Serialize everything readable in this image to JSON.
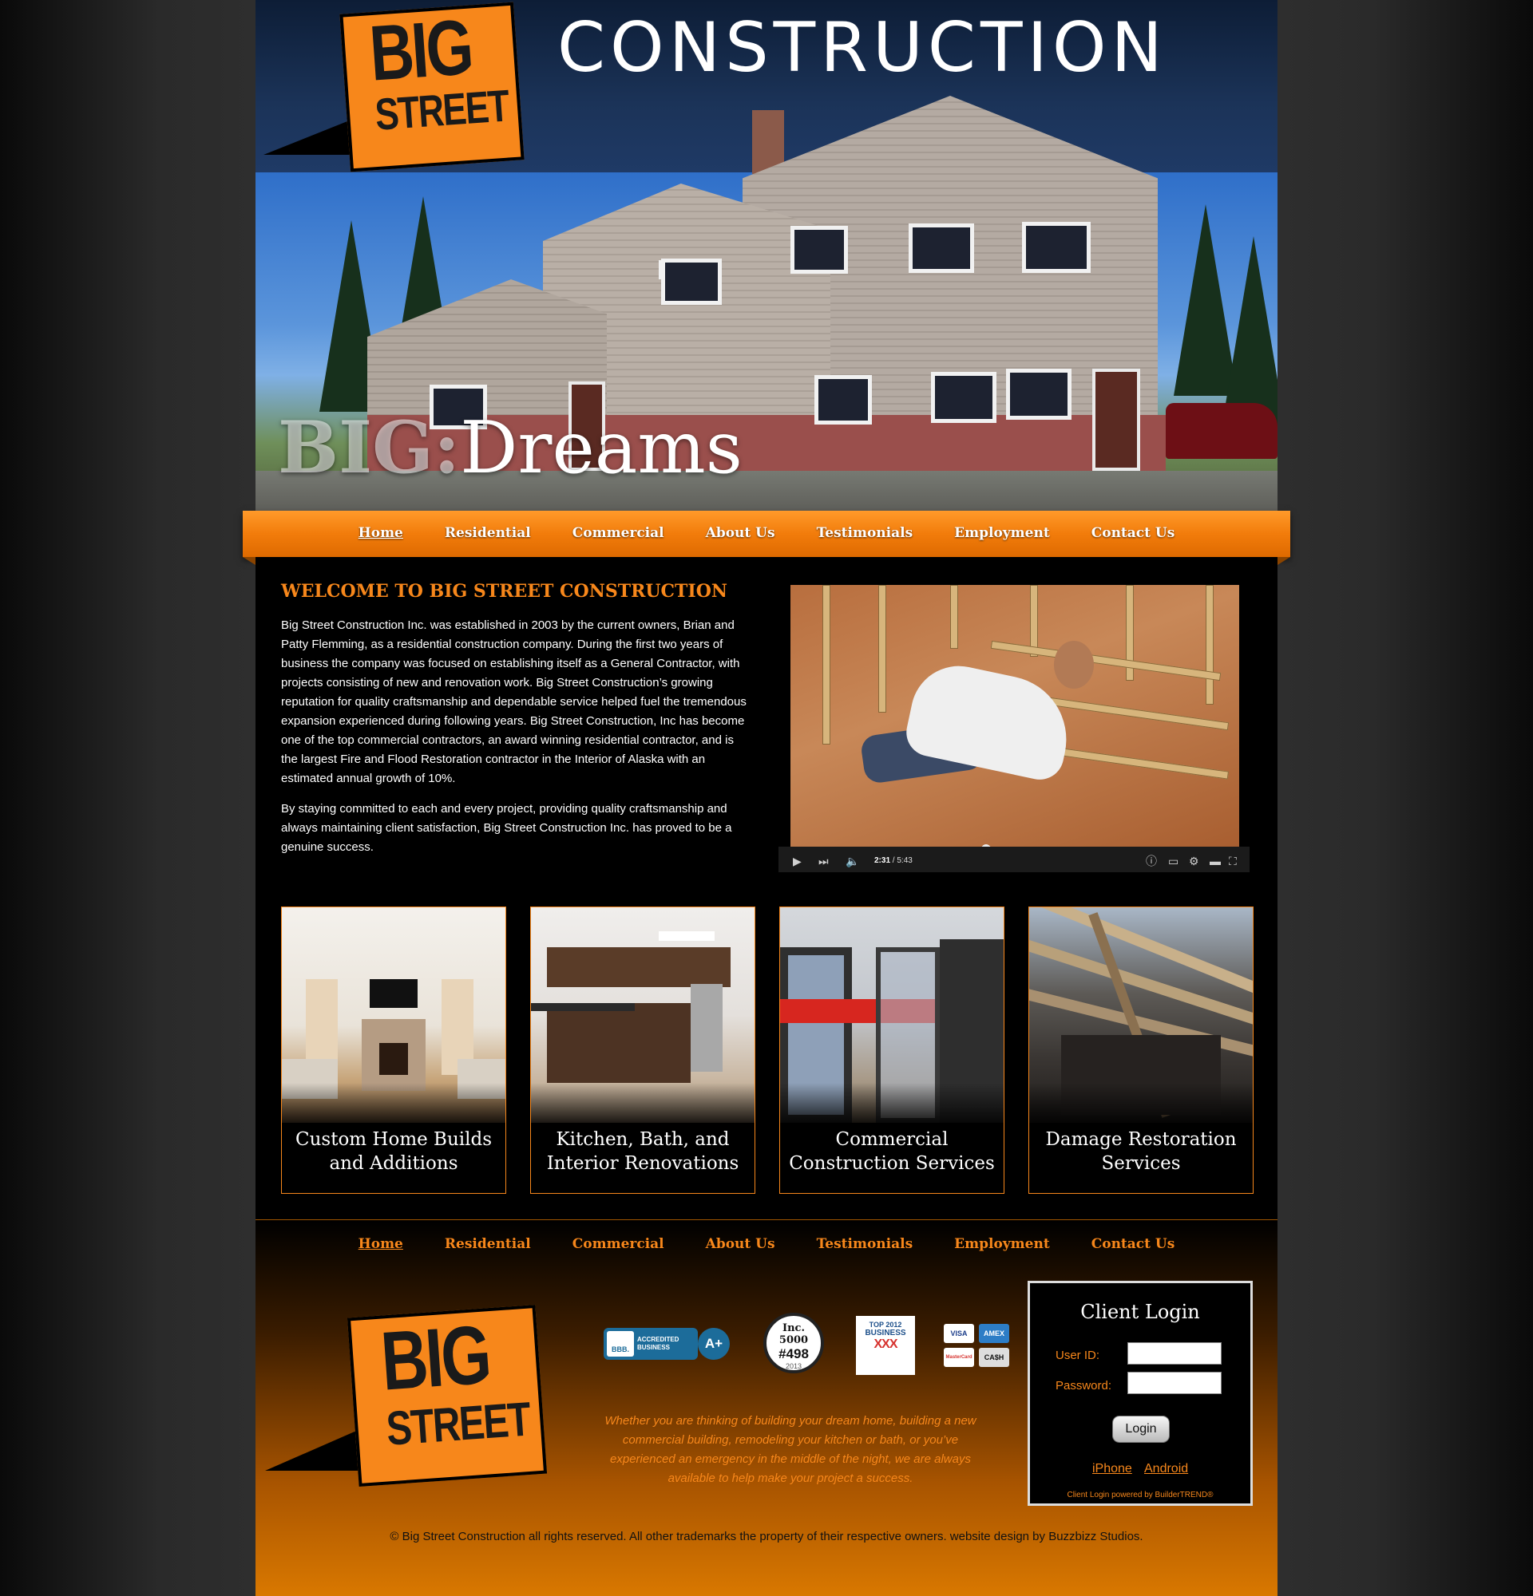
{
  "header": {
    "logo_line1": "BIG",
    "logo_line2": "STREET",
    "title": "CONSTRUCTION",
    "hero_text_bold": "BIG:",
    "hero_text": "Dreams"
  },
  "nav": {
    "items": [
      {
        "label": "Home",
        "active": true
      },
      {
        "label": "Residential"
      },
      {
        "label": "Commercial"
      },
      {
        "label": "About Us"
      },
      {
        "label": "Testimonials"
      },
      {
        "label": "Employment"
      },
      {
        "label": "Contact Us"
      }
    ]
  },
  "welcome": {
    "title": "WELCOME TO BIG STREET CONSTRUCTION",
    "paragraph1": "Big Street Construction Inc. was established in 2003 by the current owners, Brian and Patty Flemming, as a residential construction company. During the first two years of business the company was focused on establishing itself as a General Contractor, with projects consisting of new and renovation work. Big Street Construction’s growing reputation for quality craftsmanship and dependable service helped fuel the tremendous expansion experienced during following years. Big Street Construction, Inc has become one of the top commercial contractors, an award winning residential contractor, and is the largest Fire and Flood Restoration contractor in the Interior of Alaska with an estimated annual growth of 10%.",
    "paragraph2": "By staying committed to each and every project, providing quality craftsmanship and always maintaining client satisfaction, Big Street Construction Inc. has proved to be a genuine success."
  },
  "video": {
    "time_current": "2:31",
    "time_total": "/ 5:43",
    "progress": 0.44
  },
  "services": [
    {
      "title": "Custom Home Builds and Additions"
    },
    {
      "title": "Kitchen, Bath, and Interior Renovations"
    },
    {
      "title": "Commercial Construction Services"
    },
    {
      "title": "Damage Restoration Services"
    }
  ],
  "footer": {
    "nav": [
      "Home",
      "Residential",
      "Commercial",
      "About Us",
      "Testimonials",
      "Employment",
      "Contact Us"
    ],
    "badges": {
      "bbb_logo": "BBB.",
      "bbb_line1": "ACCREDITED",
      "bbb_line2": "BUSINESS",
      "bbb_rating": "A+",
      "inc_title": "Inc. 5000",
      "inc_number": "#498",
      "inc_year": "2013",
      "top_line1": "TOP 2012",
      "top_line2": "BUSINESS",
      "top_mark": "XXX",
      "pay_visa": "VISA",
      "pay_amex": "AMEX",
      "pay_mastercard": "MasterCard",
      "pay_cash": "CA$H"
    },
    "tagline": "Whether you are thinking of building your dream home, building a new commercial building, remodeling your kitchen or bath, or you’ve experienced an emergency in the middle of the night, we are always available to help make your project a success.",
    "login": {
      "title": "Client Login",
      "user_label": "User ID:",
      "password_label": "Password:",
      "button": "Login",
      "iphone": "iPhone",
      "android": "Android",
      "powered": "Client Login powered by BuilderTREND®"
    },
    "copyright": "© Big Street Construction all rights reserved. All other trademarks the property of their respective owners. website design by Buzzbizz Studios."
  }
}
